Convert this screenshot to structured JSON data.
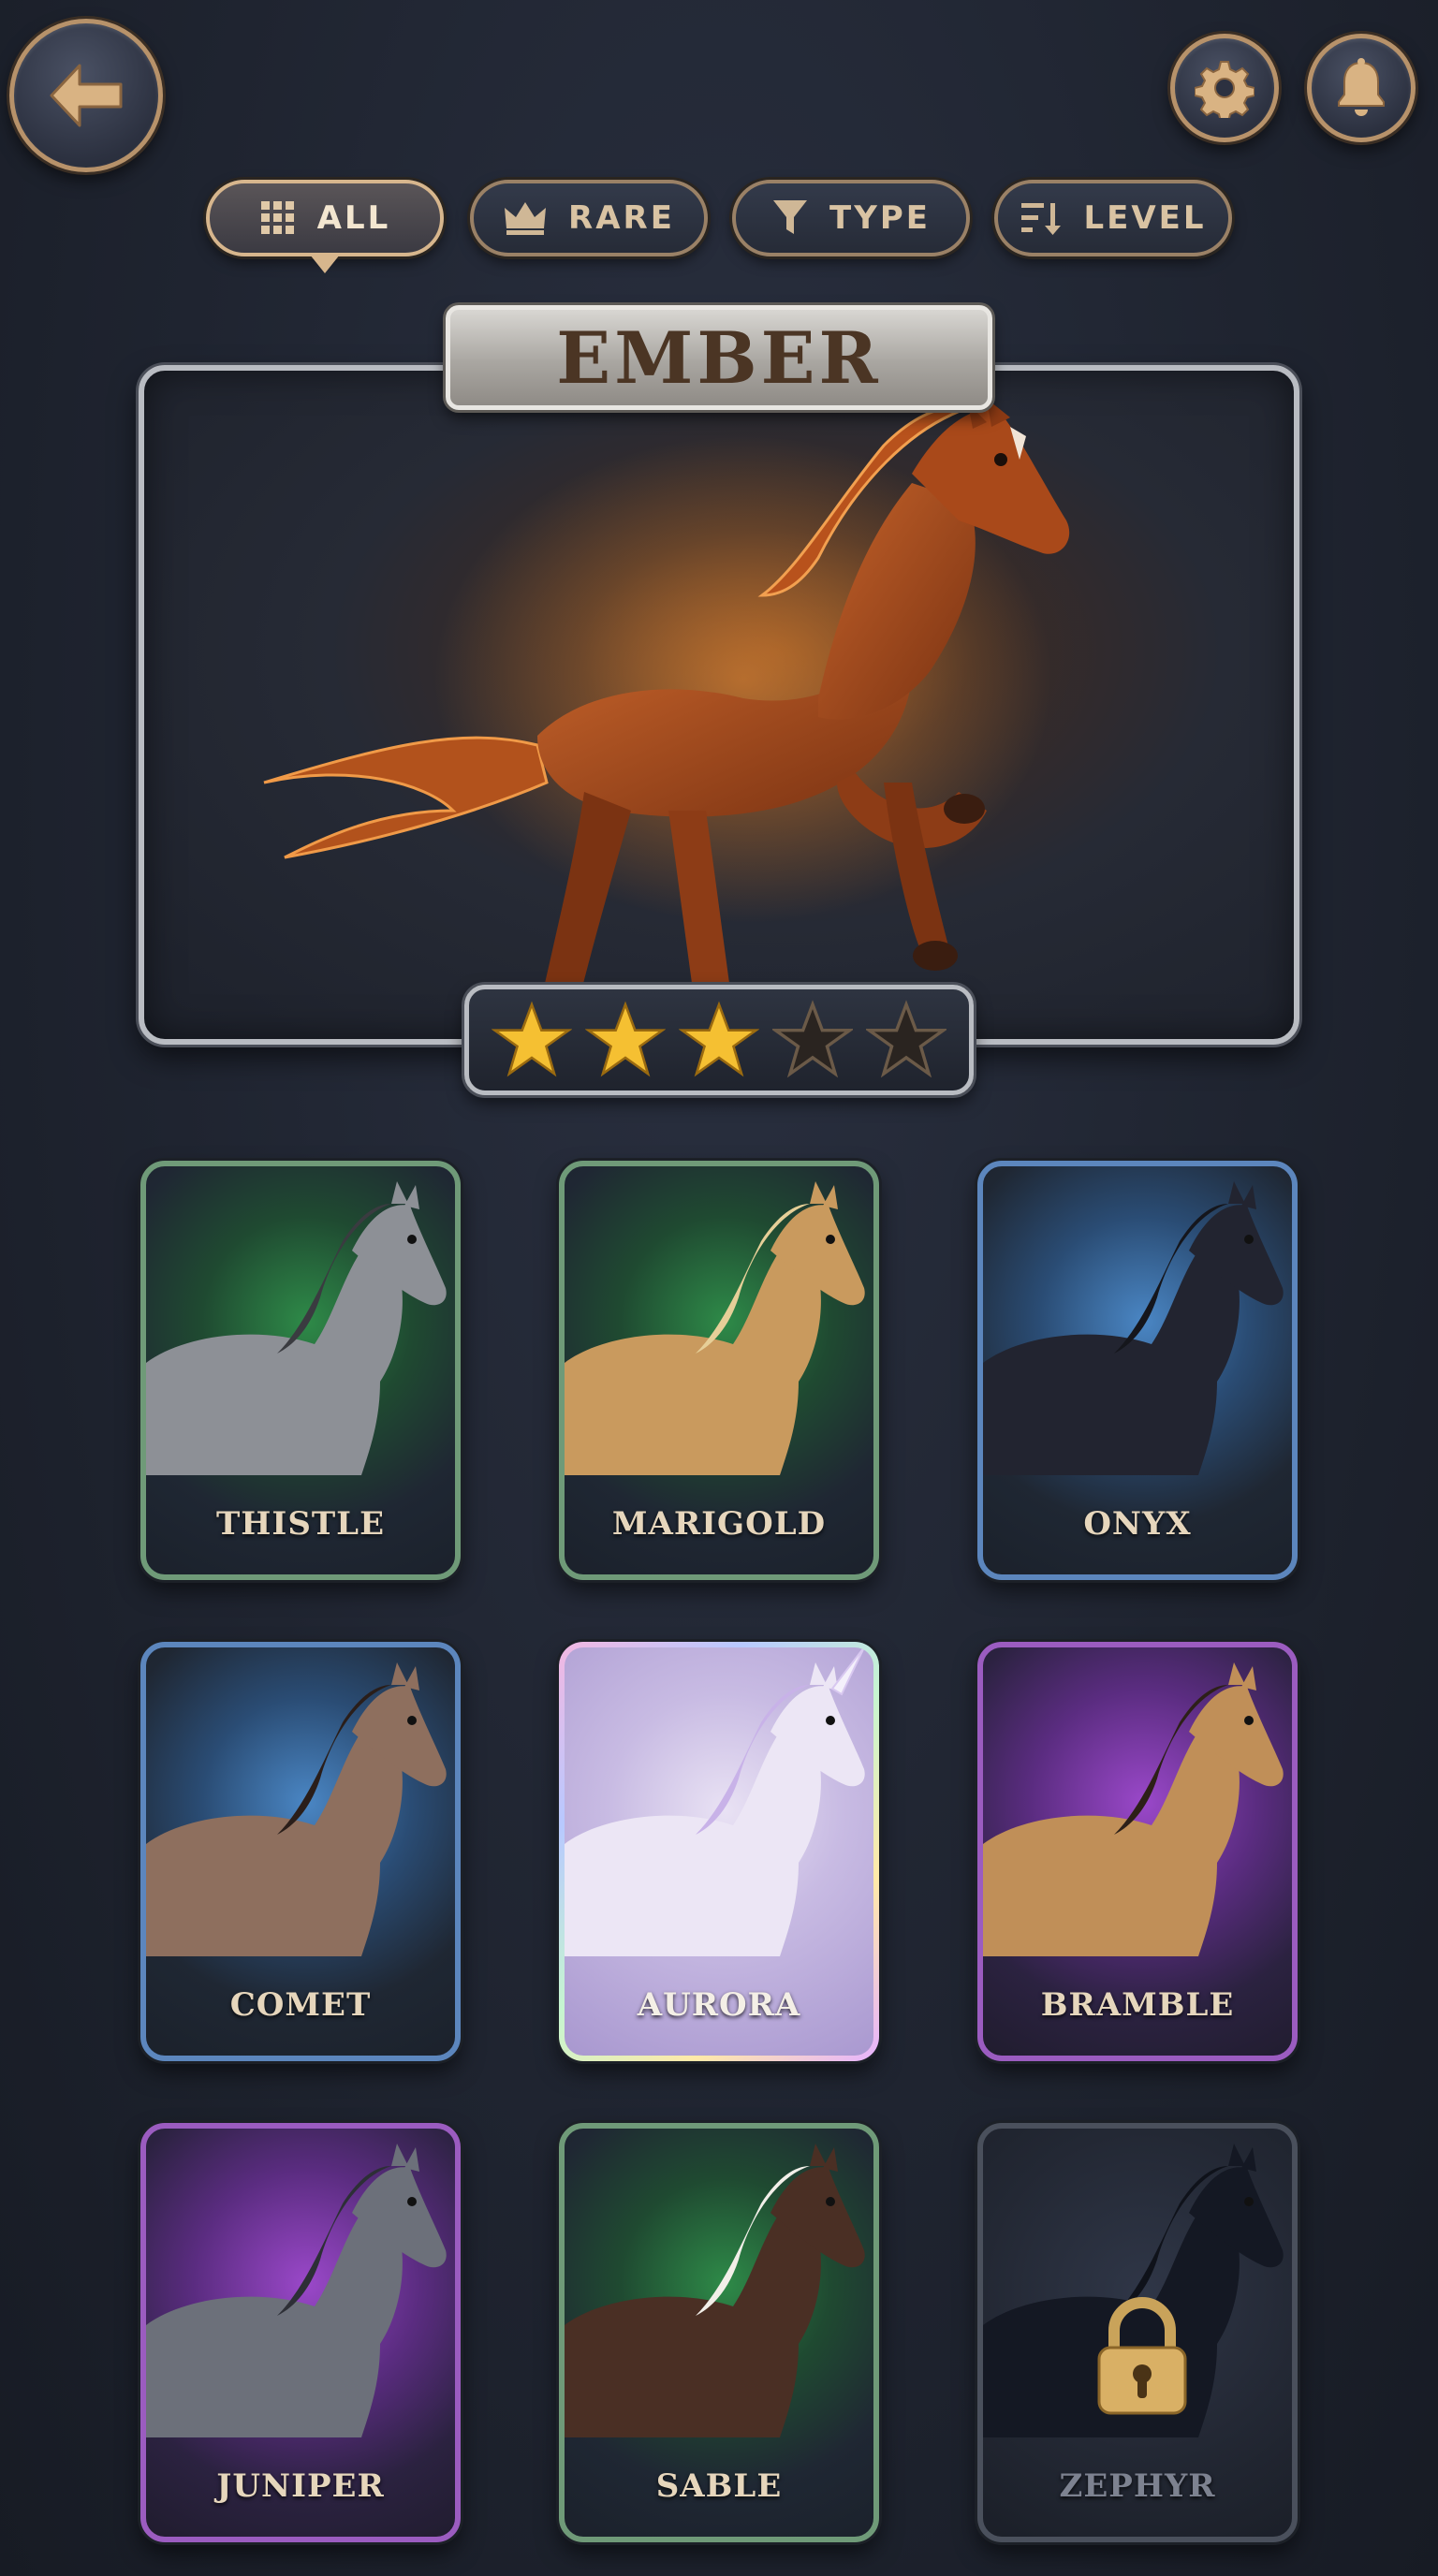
{
  "header": {
    "back_icon": "arrow-left-icon",
    "settings_icon": "gear-icon",
    "notifications_icon": "bell-icon"
  },
  "filters": [
    {
      "label": "ALL",
      "icon": "grid-icon",
      "active": true
    },
    {
      "label": "RARE",
      "icon": "crown-icon",
      "active": false
    },
    {
      "label": "TYPE",
      "icon": "funnel-icon",
      "active": false
    },
    {
      "label": "LEVEL",
      "icon": "sort-icon",
      "active": false
    }
  ],
  "featured": {
    "name": "EMBER",
    "stars_filled": 3,
    "stars_total": 5,
    "coat_color": "#9c4a1c"
  },
  "cards": [
    {
      "name": "THISTLE",
      "rarity": "green",
      "coat": "#8d9096",
      "mane": "#3a3b40"
    },
    {
      "name": "MARIGOLD",
      "rarity": "green",
      "coat": "#c99a5e",
      "mane": "#e6cf98"
    },
    {
      "name": "ONYX",
      "rarity": "blue",
      "coat": "#222430",
      "mane": "#15161c"
    },
    {
      "name": "COMET",
      "rarity": "blue",
      "coat": "#8e6f5e",
      "mane": "#2a1e1a"
    },
    {
      "name": "AURORA",
      "rarity": "holo",
      "coat": "#ece6f5",
      "mane": "#c8b2e8"
    },
    {
      "name": "BRAMBLE",
      "rarity": "purple",
      "coat": "#c08f58",
      "mane": "#2d2018"
    },
    {
      "name": "JUNIPER",
      "rarity": "purple",
      "coat": "#6c707a",
      "mane": "#2d2f36"
    },
    {
      "name": "SABLE",
      "rarity": "green",
      "coat": "#4a2f24",
      "mane": "#f2efe9"
    },
    {
      "name": "ZEPHYR",
      "rarity": "locked",
      "coat": "#141823",
      "mane": "#0f121a"
    }
  ],
  "colors": {
    "accent_gold": "#d7b68d",
    "star_gold": "#f5c032",
    "background": "#1f2430"
  }
}
